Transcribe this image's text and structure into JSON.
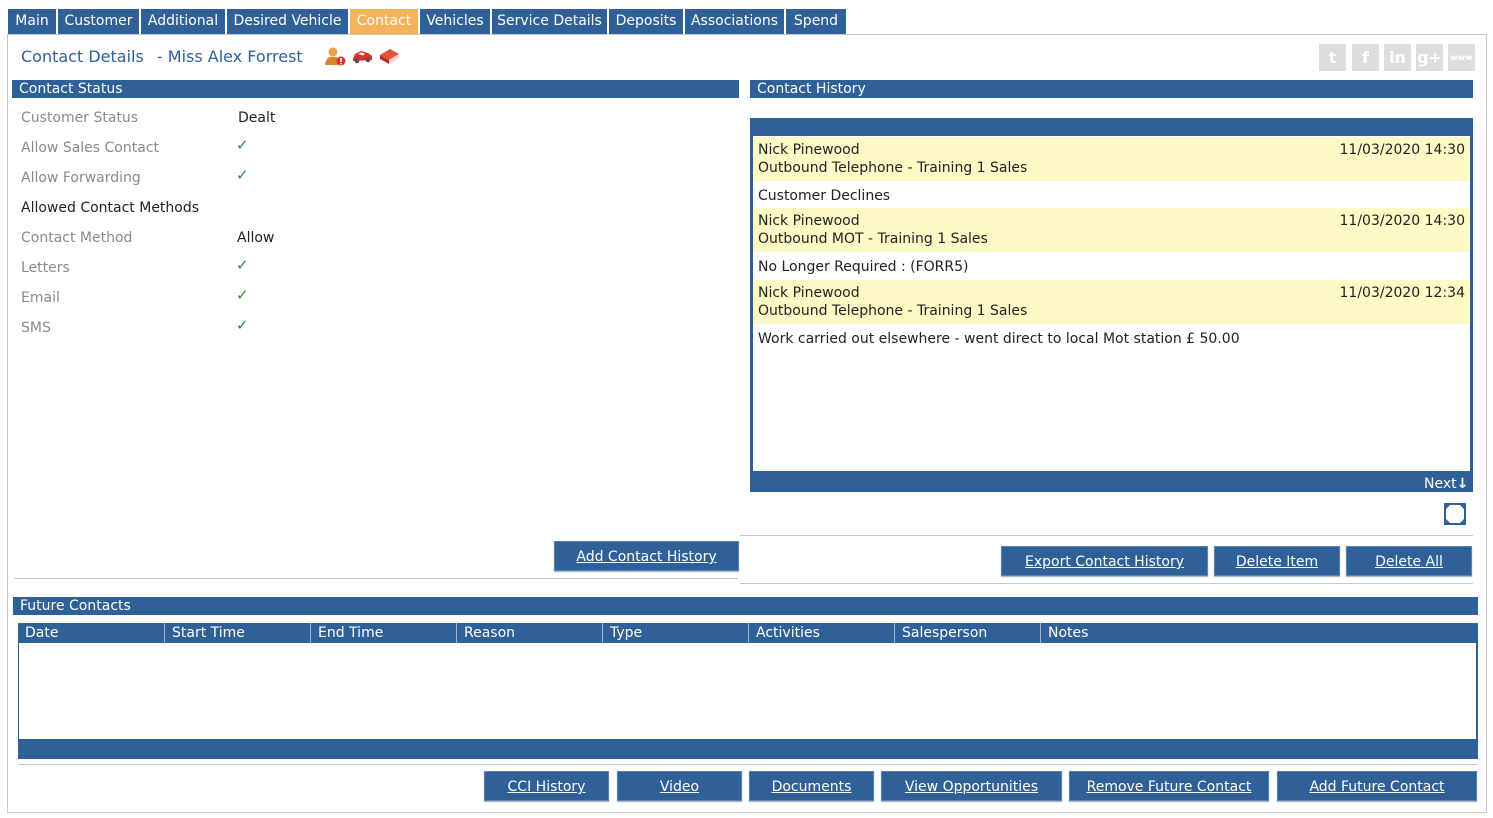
{
  "tabs": [
    {
      "label": "Main",
      "active": false
    },
    {
      "label": "Customer",
      "active": false
    },
    {
      "label": "Additional",
      "active": false
    },
    {
      "label": "Desired Vehicle",
      "active": false
    },
    {
      "label": "Contact",
      "active": true
    },
    {
      "label": "Vehicles",
      "active": false
    },
    {
      "label": "Service Details",
      "active": false
    },
    {
      "label": "Deposits",
      "active": false
    },
    {
      "label": "Associations",
      "active": false
    },
    {
      "label": "Spend",
      "active": false
    }
  ],
  "header": {
    "title": "Contact Details",
    "customer": "- Miss Alex Forrest",
    "icons": [
      "person-alert-icon",
      "car-icon",
      "book-icon"
    ],
    "social": [
      "twitter-icon",
      "facebook-icon",
      "linkedin-icon",
      "googleplus-icon",
      "www-icon"
    ]
  },
  "contact_status": {
    "heading": "Contact Status",
    "rows": [
      {
        "label": "Customer Status",
        "value": "Dealt"
      },
      {
        "label": "Allow Sales Contact",
        "value": "✓"
      },
      {
        "label": "Allow Forwarding",
        "value": "✓"
      },
      {
        "label": "Allowed Contact Methods",
        "value": ""
      },
      {
        "label": "Contact Method",
        "value": "Allow"
      },
      {
        "label": "Letters",
        "value": "✓"
      },
      {
        "label": "Email",
        "value": "✓"
      },
      {
        "label": "SMS",
        "value": "✓"
      }
    ],
    "add_button": "Add Contact History"
  },
  "contact_history": {
    "heading": "Contact History",
    "entries": [
      {
        "who": "Nick Pinewood",
        "what": "Outbound Telephone - Training 1 Sales",
        "when": "11/03/2020 14:30",
        "note": "Customer Declines"
      },
      {
        "who": "Nick Pinewood",
        "what": "Outbound MOT - Training 1 Sales",
        "when": "11/03/2020 14:30",
        "note": "No Longer Required : (FORR5)"
      },
      {
        "who": "Nick Pinewood",
        "what": "Outbound Telephone - Training 1 Sales",
        "when": "11/03/2020 12:34",
        "note": "Work carried out elsewhere - went direct to local Mot station £ 50.00"
      }
    ],
    "next_label": "Next",
    "buttons": {
      "export": "Export Contact History",
      "delete_item": "Delete Item",
      "delete_all": "Delete All"
    }
  },
  "future_contacts": {
    "heading": "Future Contacts",
    "columns": [
      "Date",
      "Start Time",
      "End Time",
      "Reason",
      "Type",
      "Activities",
      "Salesperson",
      "Notes"
    ],
    "rows": []
  },
  "footer_buttons": {
    "cci": "CCI History",
    "video": "Video",
    "documents": "Documents",
    "opportunities": "View Opportunities",
    "remove": "Remove Future Contact",
    "add": "Add Future Contact"
  },
  "colors": {
    "primary": "#2f6198",
    "active_tab": "#f6b35c",
    "highlight": "#fdfac6",
    "check": "#2a8f2a"
  }
}
